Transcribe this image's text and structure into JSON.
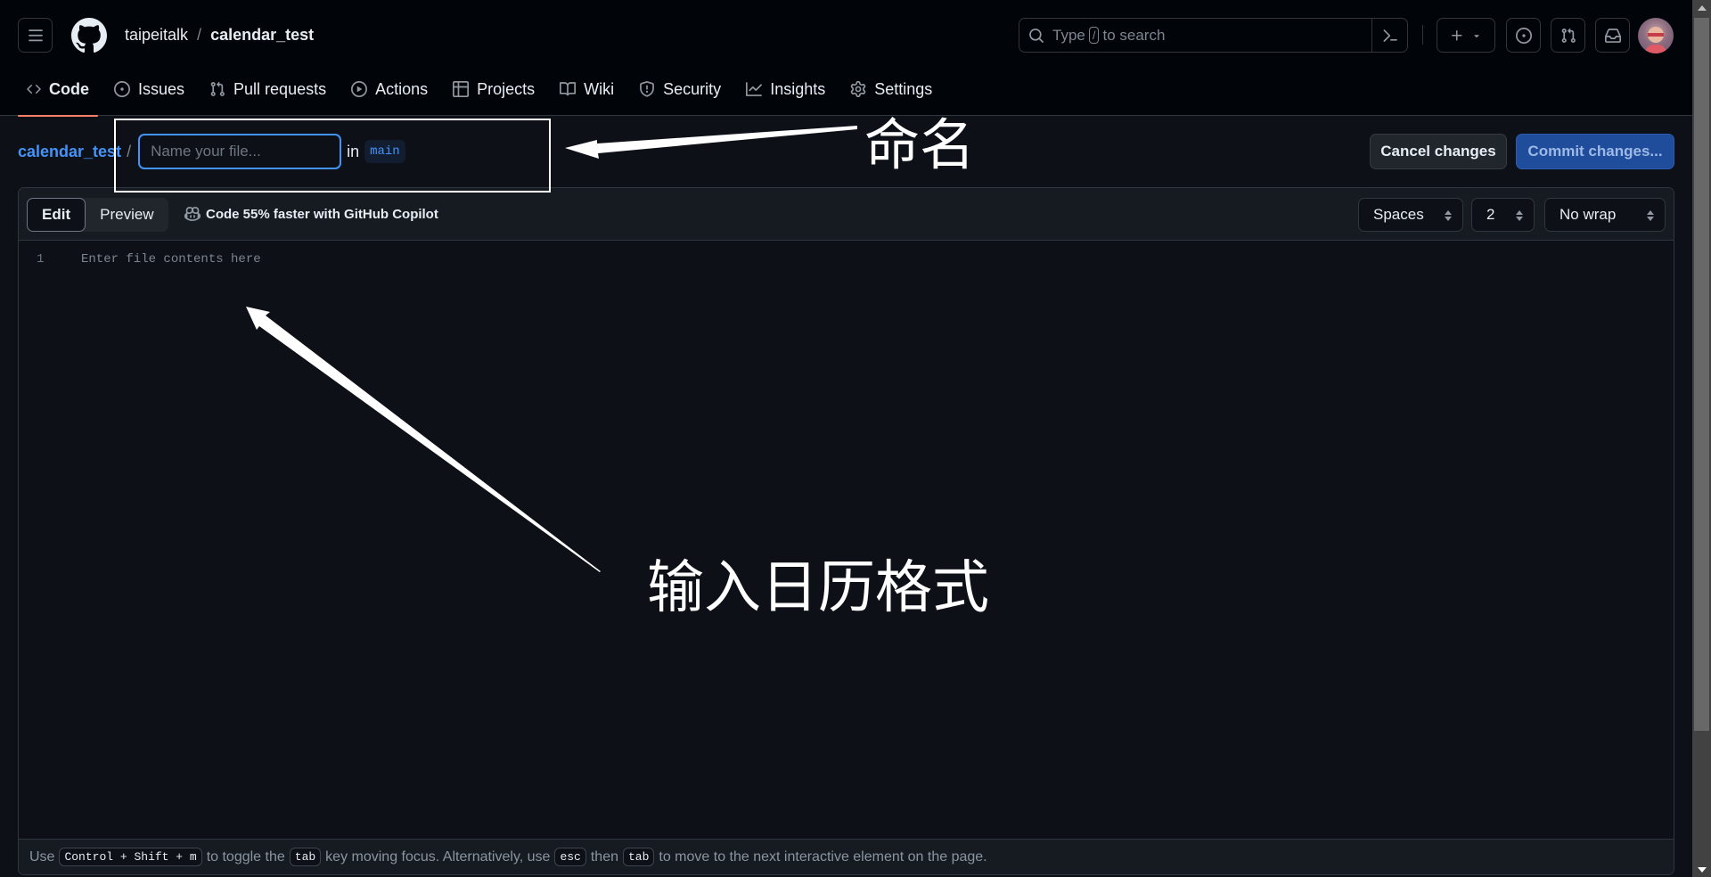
{
  "header": {
    "owner": "taipeitalk",
    "separator": "/",
    "repo": "calendar_test",
    "search_placeholder_before": "Type",
    "search_key": "/",
    "search_placeholder_after": "to search",
    "icons": [
      "hamburger-icon",
      "github-logo-icon",
      "search-icon",
      "command-palette-icon",
      "plus-icon",
      "triangle-down-icon",
      "issue-opened-icon",
      "git-pull-request-icon",
      "inbox-icon",
      "avatar"
    ]
  },
  "nav": {
    "tabs": [
      {
        "label": "Code",
        "icon": "code-icon",
        "active": true
      },
      {
        "label": "Issues",
        "icon": "issue-opened-icon"
      },
      {
        "label": "Pull requests",
        "icon": "git-pull-request-icon"
      },
      {
        "label": "Actions",
        "icon": "play-icon"
      },
      {
        "label": "Projects",
        "icon": "table-icon"
      },
      {
        "label": "Wiki",
        "icon": "book-icon"
      },
      {
        "label": "Security",
        "icon": "shield-icon"
      },
      {
        "label": "Insights",
        "icon": "graph-icon"
      },
      {
        "label": "Settings",
        "icon": "gear-icon"
      }
    ]
  },
  "path": {
    "repo": "calendar_test",
    "slash": "/",
    "filename_value": "",
    "filename_placeholder": "Name your file...",
    "in_label": "in",
    "branch": "main"
  },
  "actions": {
    "cancel": "Cancel changes",
    "commit": "Commit changes..."
  },
  "editor": {
    "tabs": [
      "Edit",
      "Preview"
    ],
    "active_tab": "Edit",
    "copilot_text": "Code 55% faster with GitHub Copilot",
    "indent_mode": "Spaces",
    "indent_size": "2",
    "wrap_mode": "No wrap",
    "line_numbers": [
      "1"
    ],
    "placeholder": "Enter file contents here"
  },
  "footer": {
    "t1": "Use",
    "k1": "Control + Shift + m",
    "t2": "to toggle the",
    "k2": "tab",
    "t3": "key moving focus. Alternatively, use",
    "k3": "esc",
    "t4": "then",
    "k4": "tab",
    "t5": "to move to the next interactive element on the page."
  },
  "annotations": {
    "name_label": "命名",
    "content_label": "输入日历格式"
  },
  "colors": {
    "accent_blue": "#4493f8",
    "active_tab_underline": "#f78166",
    "commit_button": "#1f4d9b",
    "background": "#0d1117",
    "header_background": "#010409"
  }
}
